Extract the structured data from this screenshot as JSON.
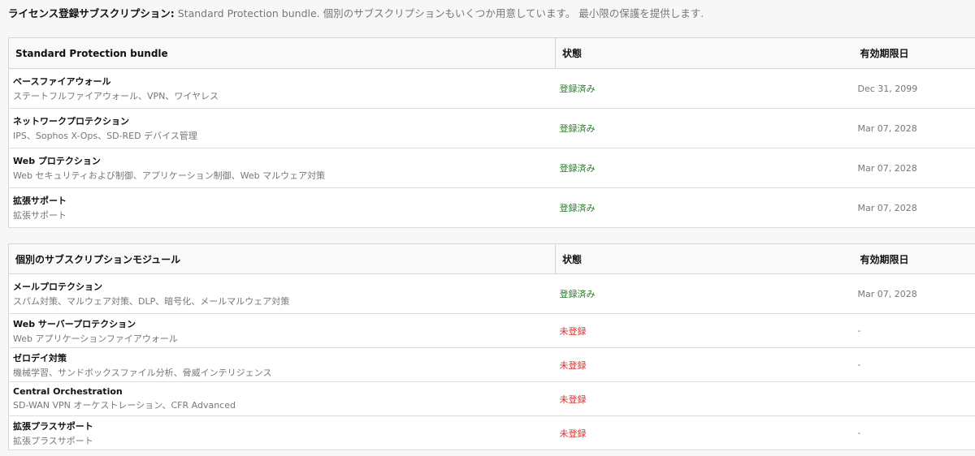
{
  "intro": {
    "label": "ライセンス登録サブスクリプション:",
    "text": "Standard Protection bundle. 個別のサブスクリプションもいくつか用意しています。 最小限の保護を提供します."
  },
  "colors": {
    "subscribed": "#2a7a2a",
    "unsubscribed": "#d8302c"
  },
  "bundle": {
    "header": {
      "name": "Standard Protection bundle",
      "status": "状態",
      "expiry": "有効期限日"
    },
    "rows": [
      {
        "name": "ベースファイアウォール",
        "desc": "ステートフルファイアウォール、VPN、ワイヤレス",
        "status": "登録済み",
        "expiry": "Dec 31, 2099"
      },
      {
        "name": "ネットワークプロテクション",
        "desc": "IPS、Sophos X-Ops、SD-RED デバイス管理",
        "status": "登録済み",
        "expiry": "Mar 07, 2028"
      },
      {
        "name": "Web プロテクション",
        "desc": "Web セキュリティおよび制御、アプリケーション制御、Web マルウェア対策",
        "status": "登録済み",
        "expiry": "Mar 07, 2028"
      },
      {
        "name": "拡張サポート",
        "desc": "拡張サポート",
        "status": "登録済み",
        "expiry": "Mar 07, 2028"
      }
    ]
  },
  "modules": {
    "header": {
      "name": "個別のサブスクリプションモジュール",
      "status": "状態",
      "expiry": "有効期限日"
    },
    "rows": [
      {
        "name": "メールプロテクション",
        "desc": "スパム対策、マルウェア対策、DLP、暗号化、メールマルウェア対策",
        "status": "登録済み",
        "expiry": "Mar 07, 2028"
      },
      {
        "name": "Web サーバープロテクション",
        "desc": "Web アプリケーションファイアウォール",
        "status": "未登録",
        "expiry": "-"
      },
      {
        "name": "ゼロデイ対策",
        "desc": "機械学習、サンドボックスファイル分析、脅威インテリジェンス",
        "status": "未登録",
        "expiry": "-"
      },
      {
        "name": "Central Orchestration",
        "desc": "SD-WAN VPN オーケストレーション、CFR Advanced",
        "status": "未登録",
        "expiry": ""
      },
      {
        "name": "拡張プラスサポート",
        "desc": "拡張プラスサポート",
        "status": "未登録",
        "expiry": "-"
      }
    ]
  }
}
